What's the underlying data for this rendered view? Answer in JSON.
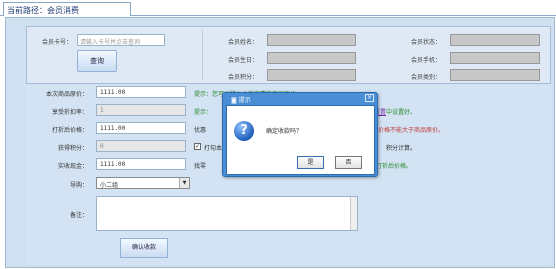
{
  "breadcrumb": {
    "text": "当前路径：会员消费"
  },
  "search": {
    "card_label": "会员卡号：",
    "card_placeholder": "请输入卡号并点击查询",
    "query_button": "查询"
  },
  "member_info": {
    "name_label": "会员姓名：",
    "birthday_label": "会员生日：",
    "points_label": "会员积分：",
    "status_label": "会员状态：",
    "phone_label": "会员手机：",
    "type_label": "会员类别："
  },
  "form": {
    "original_price_label": "本次商品原价：",
    "original_price_value": "1111.00",
    "original_price_hint": "提示：您可以输入本次消费的商品原价",
    "discount_label": "享受折扣率：",
    "discount_value": "1",
    "discount_hint_prefix": "提示：",
    "discount_hint_link": "员分类设置",
    "discount_hint_suffix": "中设置好。",
    "discounted_price_label": "打折后价格：",
    "discounted_price_value": "1111.00",
    "discounted_price_hint_prefix": "优惠",
    "discounted_price_hint_red": "折后价格不能大于商品原价。",
    "points_earned_label": "获得积分：",
    "points_earned_value": "0",
    "points_hint_prefix": "打勾本",
    "points_hint_red": "积分计算。",
    "cash_label": "实收现金：",
    "cash_value": "1111.00",
    "cash_hint_prefix": "找零",
    "cash_hint_suffix": "打折后价格。",
    "guide_label": "导购：",
    "guide_value": "小二组",
    "remark_label": "备注：",
    "confirm_button": "确认收款"
  },
  "dialog": {
    "title": "提示",
    "message": "确定收款吗？",
    "yes_label": "是",
    "no_label": "否",
    "close_glyph": "×",
    "icon_glyph": "?"
  }
}
